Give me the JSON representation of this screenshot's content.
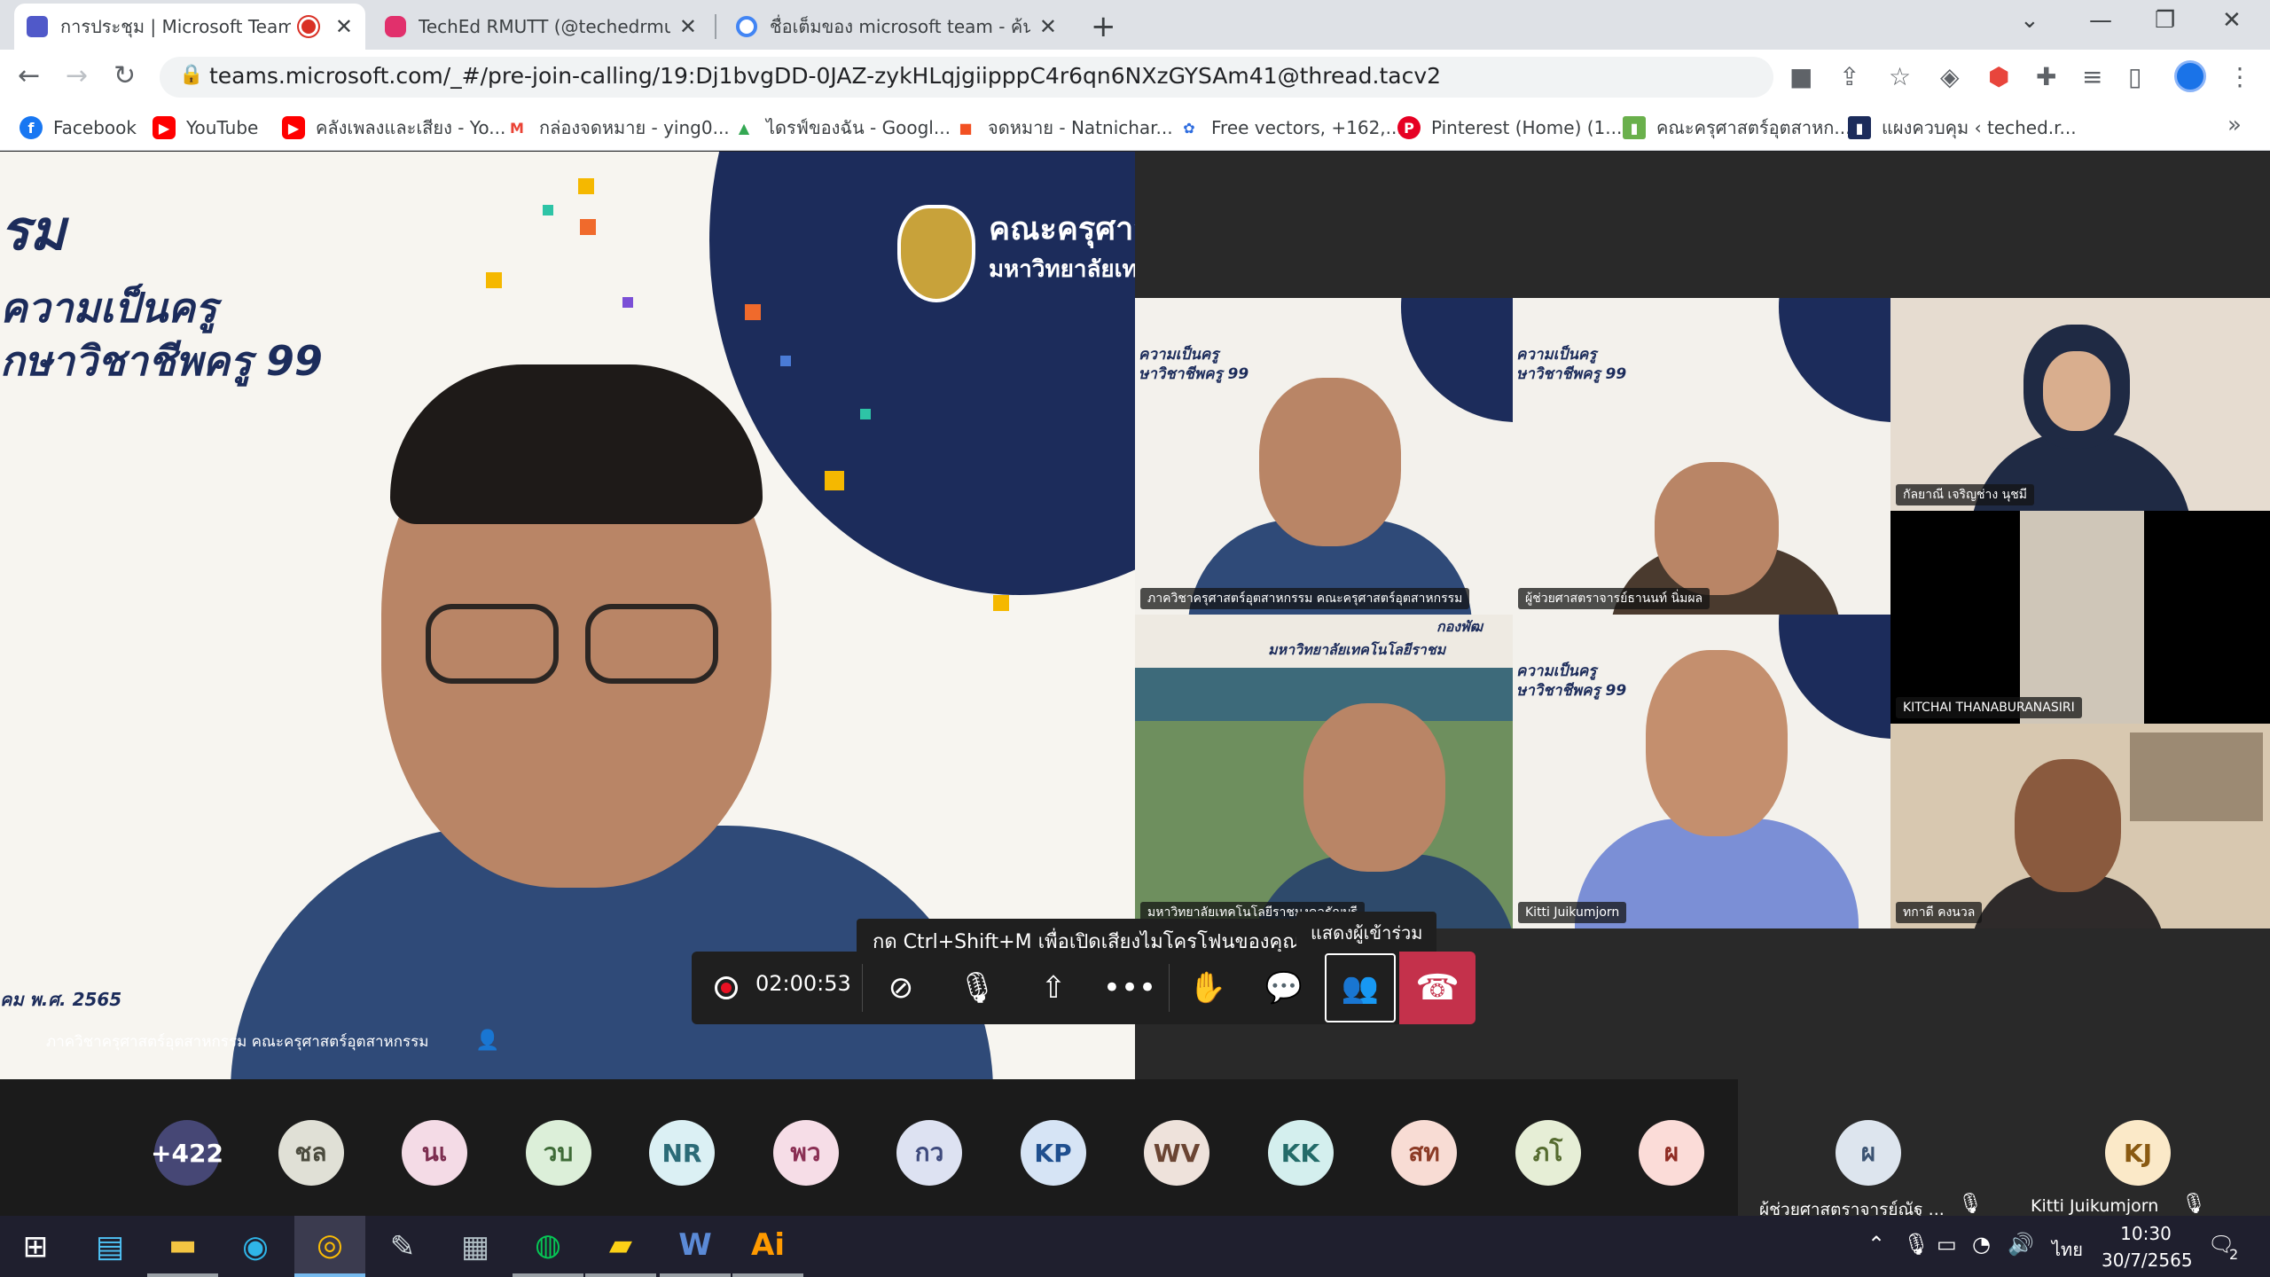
{
  "browser": {
    "tabs": [
      {
        "title": "การประชุม | Microsoft Teams",
        "active": true,
        "recording": true,
        "favicon_color": "#5059c9"
      },
      {
        "title": "TechEd RMUTT (@techedrmutt) •",
        "active": false,
        "favicon_color": "#e1306c"
      },
      {
        "title": "ชื่อเต็มของ microsoft team - ค้นหาด้วย",
        "active": false,
        "favicon_color": "#4285f4"
      }
    ],
    "new_tab_symbol": "+",
    "url": "teams.microsoft.com/_#/pre-join-calling/19:Dj1bvgDD-0JAZ-zykHLqjgiipppC4r6qn6NXzGYSAm41@thread.tacv2",
    "bookmarks": [
      {
        "label": "Facebook",
        "icon_color": "#1877f2",
        "glyph": "f"
      },
      {
        "label": "YouTube",
        "icon_color": "#ff0000",
        "glyph": "▶"
      },
      {
        "label": "คลังเพลงและเสียง - Yo...",
        "icon_color": "#ff0000",
        "glyph": "▶"
      },
      {
        "label": "กล่องจดหมาย - ying0...",
        "icon_color": "#ea4335",
        "glyph": "M"
      },
      {
        "label": "ไดรฟ์ของฉัน - Googl...",
        "icon_color": "#34a853",
        "glyph": "▲"
      },
      {
        "label": "จดหมาย - Natnichar...",
        "icon_color": "#f25022",
        "glyph": "■"
      },
      {
        "label": "Free vectors, +162,...",
        "icon_color": "#2d6cdf",
        "glyph": "✿"
      },
      {
        "label": "Pinterest (Home) (1...",
        "icon_color": "#e60023",
        "glyph": "P"
      },
      {
        "label": "คณะครุศาสตร์อุตสาหก...",
        "icon_color": "#6ab04c",
        "glyph": "▮"
      },
      {
        "label": "แผงควบคุม ‹ teched.r...",
        "icon_color": "#1c2c5b",
        "glyph": "▮"
      }
    ],
    "more_symbol": "»"
  },
  "main_video": {
    "banner_line1": "รม",
    "banner_line2": "ความเป็นครู",
    "banner_line3": "ุกษาวิชาชีพครู 99",
    "faculty_name": "คณะครุศาส",
    "faculty_sub": "มหาวิทยาลัยเทค",
    "date_caption": "คม พ.ศ. 2565",
    "speaker_name": "ภาควิชาครุศาสตร์อุตสาหกรรม คณะครุศาสตร์อุตสาหกรรม"
  },
  "grid": [
    {
      "name": "ภาควิชาครุศาสตร์อุตสาหกรรม คณะครุศาสตร์อุตสาหกรรม",
      "bg": "#f3f1ec",
      "head": "#b98566",
      "body": "#2f4a78"
    },
    {
      "name": "ผู้ช่วยศาสตราจารย์ธานนท์ นิ่มผล",
      "bg": "#f3f1ec",
      "head": "#b98566",
      "body": "#4a3a2e"
    },
    {
      "name": "กัลยาณี เจริญช่าง นุชมี",
      "bg": "#e6dcd0",
      "head": "#d9ae8e",
      "body": "#1f2a44"
    },
    {
      "name": "มหาวิทยาลัยเทคโนโลยีราชมงคลธัญบุรี",
      "bg": "#3d6a7a",
      "head": "#b98566",
      "body": "#2e4a6b"
    },
    {
      "name": "Kitti Juikumjorn",
      "bg": "#f3f1ec",
      "head": "#c48f6e",
      "body": "#7b8fd6"
    },
    {
      "name": "KITCHAI THANABURANASIRI",
      "bg": "#000000",
      "head": "#cfc6b8",
      "body": "#c9bfb0"
    },
    {
      "name": "ทกาดี คงนวล",
      "bg": "#d8c8b0",
      "head": "#8a5a3e",
      "body": "#2e2a2a"
    }
  ],
  "grid_banner": {
    "t1": "ความเป็นครู",
    "t2": "ษาวิชาชีพครู 99",
    "t3": "คณะครุศ",
    "t4": "กองพัฒ",
    "t5": "มหาวิทยาลัยเทคโนโลยีราชม"
  },
  "tooltips": {
    "unmute_hint": "กด Ctrl+Shift+M เพื่อเปิดเสียงไมโครโฟนของคุณ",
    "participants": "แสดงผู้เข้าร่วม"
  },
  "controls": {
    "timer": "02:00:53",
    "camera_icon": "camera-off-icon",
    "mic_icon": "mic-off-icon",
    "share_icon": "share-tray-icon",
    "more_icon": "more-actions-icon",
    "raise_hand_icon": "raise-hand-icon",
    "chat_icon": "chat-icon",
    "participants_icon": "participants-icon",
    "leave_icon": "hang-up-icon",
    "leave_color": "#c4314b"
  },
  "attendees": [
    {
      "label": "+422",
      "bg": "#464775",
      "fg": "#ffffff"
    },
    {
      "label": "ชล",
      "bg": "#e0e0d6",
      "fg": "#4b4b3e"
    },
    {
      "label": "นเ",
      "bg": "#f4dbe6",
      "fg": "#7c2e50"
    },
    {
      "label": "วบ",
      "bg": "#dcefd9",
      "fg": "#3e6b37"
    },
    {
      "label": "NR",
      "bg": "#dbf0f4",
      "fg": "#2b6b77"
    },
    {
      "label": "พว",
      "bg": "#f6dde7",
      "fg": "#8a2f54"
    },
    {
      "label": "กว",
      "bg": "#dde2f2",
      "fg": "#3e4a7d"
    },
    {
      "label": "KP",
      "bg": "#d6e4f5",
      "fg": "#1f4f8f"
    },
    {
      "label": "WV",
      "bg": "#eee2db",
      "fg": "#6b4533"
    },
    {
      "label": "KK",
      "bg": "#d4efee",
      "fg": "#236b69"
    },
    {
      "label": "สท",
      "bg": "#f8dcd4",
      "fg": "#8c3b26"
    },
    {
      "label": "ภโ",
      "bg": "#e6eed6",
      "fg": "#556b2f"
    },
    {
      "label": "ผ",
      "bg": "#fbdcd8",
      "fg": "#8f2c24"
    }
  ],
  "pinned_attendees": [
    {
      "initials": "ผ",
      "name": "ผู้ช่วยศาสตราจารย์ณัฐ ...",
      "bg": "#dde5ee",
      "fg": "#3b5372"
    },
    {
      "initials": "KJ",
      "name": "Kitti Juikumjorn",
      "bg": "#fbe9c8",
      "fg": "#8a5a12"
    }
  ],
  "taskbar": {
    "apps": [
      {
        "name": "start",
        "glyph": "⊞",
        "color": "#ffffff"
      },
      {
        "name": "contacts",
        "glyph": "▤",
        "color": "#4fc3f7"
      },
      {
        "name": "file-explorer",
        "glyph": "▬",
        "color": "#f4c542"
      },
      {
        "name": "edge",
        "glyph": "◉",
        "color": "#2fb5e8"
      },
      {
        "name": "chrome",
        "glyph": "◎",
        "color": "#fbbc05"
      },
      {
        "name": "paint",
        "glyph": "✎",
        "color": "#cfd8dc"
      },
      {
        "name": "printer",
        "glyph": "▦",
        "color": "#b0bec5"
      },
      {
        "name": "line",
        "glyph": "◍",
        "color": "#06c755"
      },
      {
        "name": "sticky-notes",
        "glyph": "▰",
        "color": "#fcd116"
      },
      {
        "name": "word",
        "glyph": "W",
        "color": "#2b579a"
      },
      {
        "name": "illustrator",
        "glyph": "Ai",
        "color": "#ff9a00"
      }
    ],
    "language": "ไทย",
    "time": "10:30",
    "date": "30/7/2565",
    "notif_count": "2"
  }
}
